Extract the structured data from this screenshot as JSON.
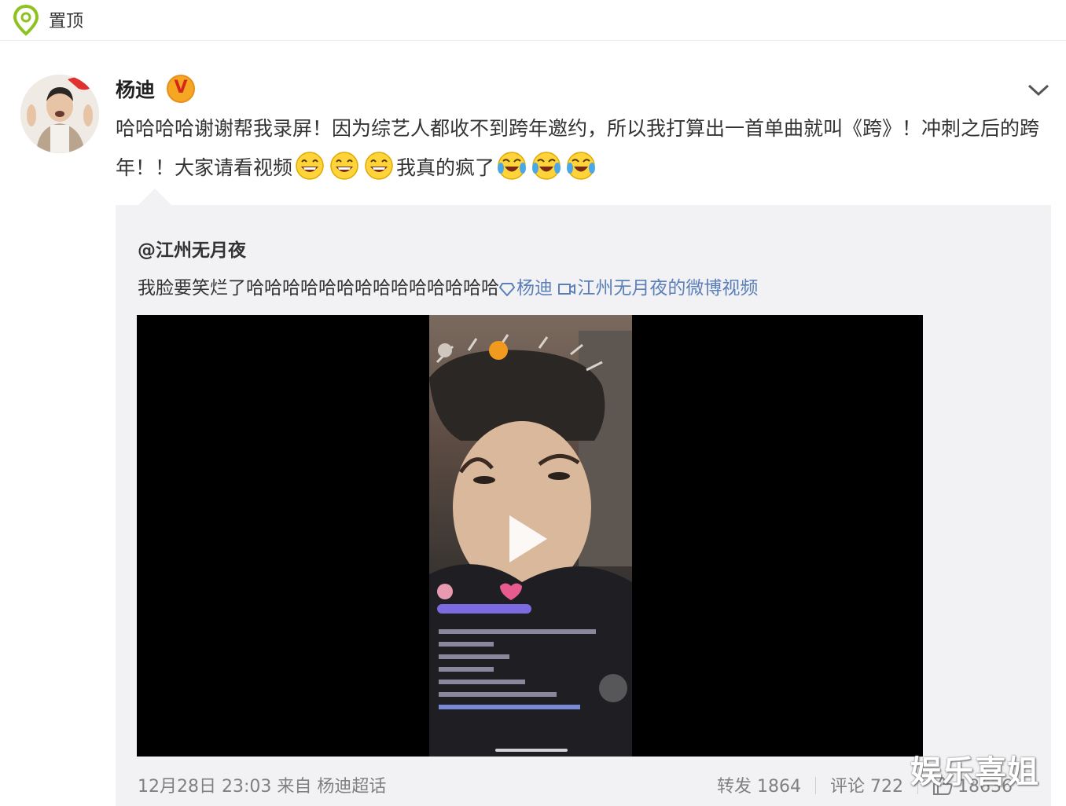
{
  "pin": {
    "label": "置顶",
    "icon": "location-pin-icon"
  },
  "post": {
    "author": "杨迪",
    "verified_badge": "V",
    "text_part1": "哈哈哈哈谢谢帮我录屏！因为综艺人都收不到跨年邀约，所以我打算出一首单曲就叫《跨》！冲刺之后的跨年！！大家请看视频",
    "text_part2": "我真的疯了",
    "emoji_laugh": "grinning-sweat-emoji",
    "emoji_cry": "crying-laughing-emoji"
  },
  "repost": {
    "original_author": "@江州无月夜",
    "text": "我脸要笑烂了哈哈哈哈哈哈哈哈哈哈哈哈哈哈",
    "mention": "杨迪",
    "video_link": "江州无月夜的微博视频"
  },
  "footer": {
    "timestamp": "12月28日 23:03",
    "source_prefix": "来自",
    "source": "杨迪超话",
    "repost_label": "转发",
    "repost_count": "1864",
    "comment_label": "评论",
    "comment_count": "722",
    "like_count": "18636"
  },
  "watermark": "娱乐喜姐",
  "colors": {
    "link": "#5b7fb7",
    "pin_green": "#8dc21f",
    "badge_orange": "#f5a623",
    "badge_red": "#d6271b"
  }
}
